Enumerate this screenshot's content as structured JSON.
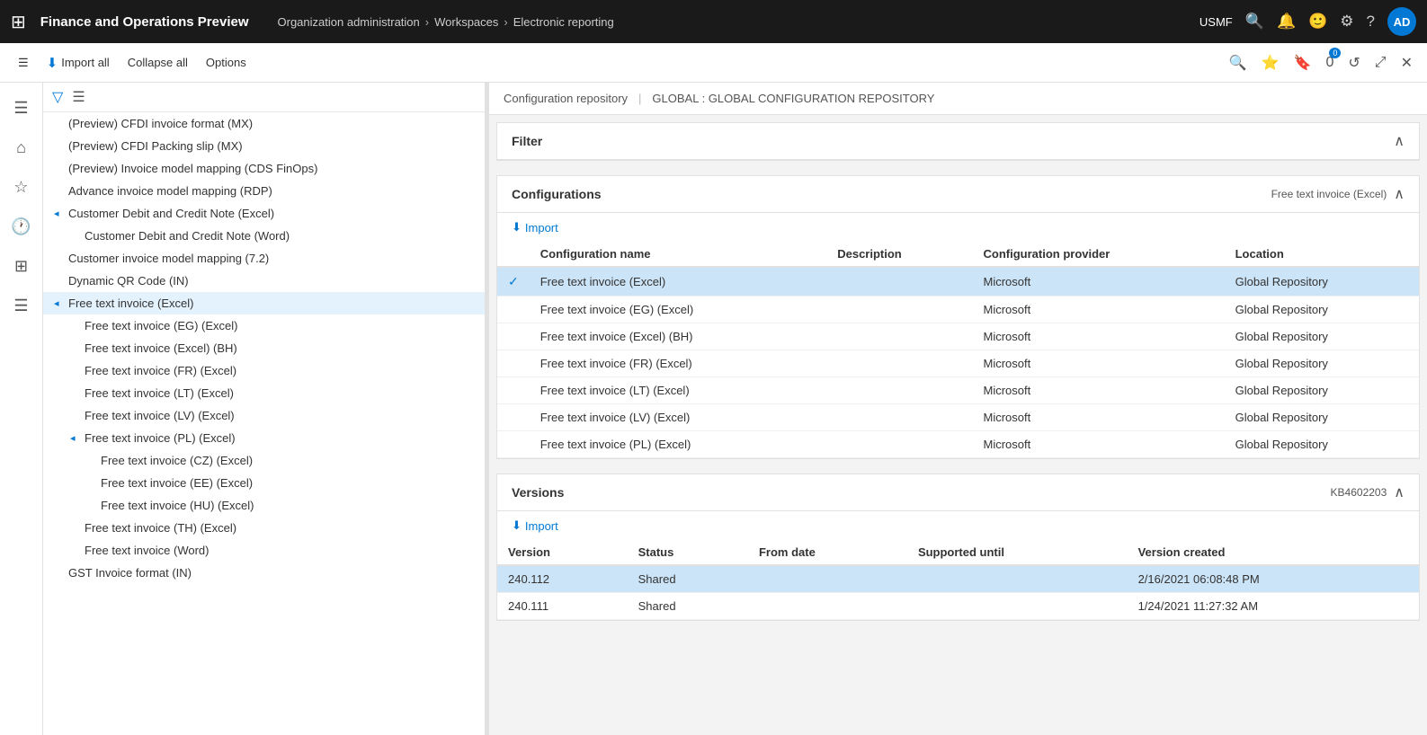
{
  "topNav": {
    "appTitle": "Finance and Operations Preview",
    "breadcrumb": [
      {
        "label": "Organization administration",
        "href": "#"
      },
      {
        "label": "Workspaces",
        "href": "#"
      },
      {
        "label": "Electronic reporting",
        "href": "#"
      }
    ],
    "company": "USMF",
    "avatar": "AD"
  },
  "toolbar": {
    "importAll": "Import all",
    "collapseAll": "Collapse all",
    "options": "Options"
  },
  "contentHeader": {
    "left": "Configuration repository",
    "separator": "|",
    "right": "GLOBAL : GLOBAL CONFIGURATION REPOSITORY"
  },
  "filter": {
    "title": "Filter"
  },
  "configurations": {
    "title": "Configurations",
    "rightLabel": "Free text invoice (Excel)",
    "importBtn": "Import",
    "columns": [
      "",
      "Configuration name",
      "Description",
      "Configuration provider",
      "Location"
    ],
    "rows": [
      {
        "selected": true,
        "name": "Free text invoice (Excel)",
        "description": "",
        "provider": "Microsoft",
        "location": "Global Repository"
      },
      {
        "selected": false,
        "name": "Free text invoice (EG) (Excel)",
        "description": "",
        "provider": "Microsoft",
        "location": "Global Repository"
      },
      {
        "selected": false,
        "name": "Free text invoice (Excel) (BH)",
        "description": "",
        "provider": "Microsoft",
        "location": "Global Repository"
      },
      {
        "selected": false,
        "name": "Free text invoice (FR) (Excel)",
        "description": "",
        "provider": "Microsoft",
        "location": "Global Repository"
      },
      {
        "selected": false,
        "name": "Free text invoice (LT) (Excel)",
        "description": "",
        "provider": "Microsoft",
        "location": "Global Repository"
      },
      {
        "selected": false,
        "name": "Free text invoice (LV) (Excel)",
        "description": "",
        "provider": "Microsoft",
        "location": "Global Repository"
      },
      {
        "selected": false,
        "name": "Free text invoice (PL) (Excel)",
        "description": "",
        "provider": "Microsoft",
        "location": "Global Repository"
      }
    ]
  },
  "versions": {
    "title": "Versions",
    "rightLabel": "KB4602203",
    "importBtn": "Import",
    "columns": [
      "Version",
      "Status",
      "From date",
      "Supported until",
      "Version created"
    ],
    "rows": [
      {
        "version": "240.112",
        "status": "Shared",
        "fromDate": "",
        "supportedUntil": "",
        "versionCreated": "2/16/2021 06:08:48 PM"
      },
      {
        "version": "240.111",
        "status": "Shared",
        "fromDate": "",
        "supportedUntil": "",
        "versionCreated": "1/24/2021 11:27:32 AM"
      }
    ]
  },
  "tree": {
    "items": [
      {
        "level": 1,
        "label": "(Preview) CFDI invoice format (MX)",
        "hasChildren": false,
        "expanded": false,
        "selected": false
      },
      {
        "level": 1,
        "label": "(Preview) CFDI Packing slip (MX)",
        "hasChildren": false,
        "expanded": false,
        "selected": false
      },
      {
        "level": 1,
        "label": "(Preview) Invoice model mapping (CDS FinOps)",
        "hasChildren": false,
        "expanded": false,
        "selected": false
      },
      {
        "level": 1,
        "label": "Advance invoice model mapping (RDP)",
        "hasChildren": false,
        "expanded": false,
        "selected": false
      },
      {
        "level": 1,
        "label": "Customer Debit and Credit Note (Excel)",
        "hasChildren": true,
        "expanded": true,
        "selected": false
      },
      {
        "level": 2,
        "label": "Customer Debit and Credit Note (Word)",
        "hasChildren": false,
        "expanded": false,
        "selected": false
      },
      {
        "level": 1,
        "label": "Customer invoice model mapping (7.2)",
        "hasChildren": false,
        "expanded": false,
        "selected": false
      },
      {
        "level": 1,
        "label": "Dynamic QR Code (IN)",
        "hasChildren": false,
        "expanded": false,
        "selected": false
      },
      {
        "level": 1,
        "label": "Free text invoice (Excel)",
        "hasChildren": true,
        "expanded": true,
        "selected": true
      },
      {
        "level": 2,
        "label": "Free text invoice (EG) (Excel)",
        "hasChildren": false,
        "expanded": false,
        "selected": false
      },
      {
        "level": 2,
        "label": "Free text invoice (Excel) (BH)",
        "hasChildren": false,
        "expanded": false,
        "selected": false
      },
      {
        "level": 2,
        "label": "Free text invoice (FR) (Excel)",
        "hasChildren": false,
        "expanded": false,
        "selected": false
      },
      {
        "level": 2,
        "label": "Free text invoice (LT) (Excel)",
        "hasChildren": false,
        "expanded": false,
        "selected": false
      },
      {
        "level": 2,
        "label": "Free text invoice (LV) (Excel)",
        "hasChildren": false,
        "expanded": false,
        "selected": false
      },
      {
        "level": 2,
        "label": "Free text invoice (PL) (Excel)",
        "hasChildren": true,
        "expanded": true,
        "selected": false
      },
      {
        "level": 3,
        "label": "Free text invoice (CZ) (Excel)",
        "hasChildren": false,
        "expanded": false,
        "selected": false
      },
      {
        "level": 3,
        "label": "Free text invoice (EE) (Excel)",
        "hasChildren": false,
        "expanded": false,
        "selected": false
      },
      {
        "level": 3,
        "label": "Free text invoice (HU) (Excel)",
        "hasChildren": false,
        "expanded": false,
        "selected": false
      },
      {
        "level": 2,
        "label": "Free text invoice (TH) (Excel)",
        "hasChildren": false,
        "expanded": false,
        "selected": false
      },
      {
        "level": 2,
        "label": "Free text invoice (Word)",
        "hasChildren": false,
        "expanded": false,
        "selected": false
      },
      {
        "level": 1,
        "label": "GST Invoice format (IN)",
        "hasChildren": false,
        "expanded": false,
        "selected": false
      }
    ]
  },
  "sidebarIcons": [
    {
      "name": "home-icon",
      "glyph": "⌂"
    },
    {
      "name": "star-icon",
      "glyph": "☆"
    },
    {
      "name": "clock-icon",
      "glyph": "🕐"
    },
    {
      "name": "grid-icon",
      "glyph": "⊞"
    },
    {
      "name": "list-icon",
      "glyph": "☰"
    }
  ]
}
